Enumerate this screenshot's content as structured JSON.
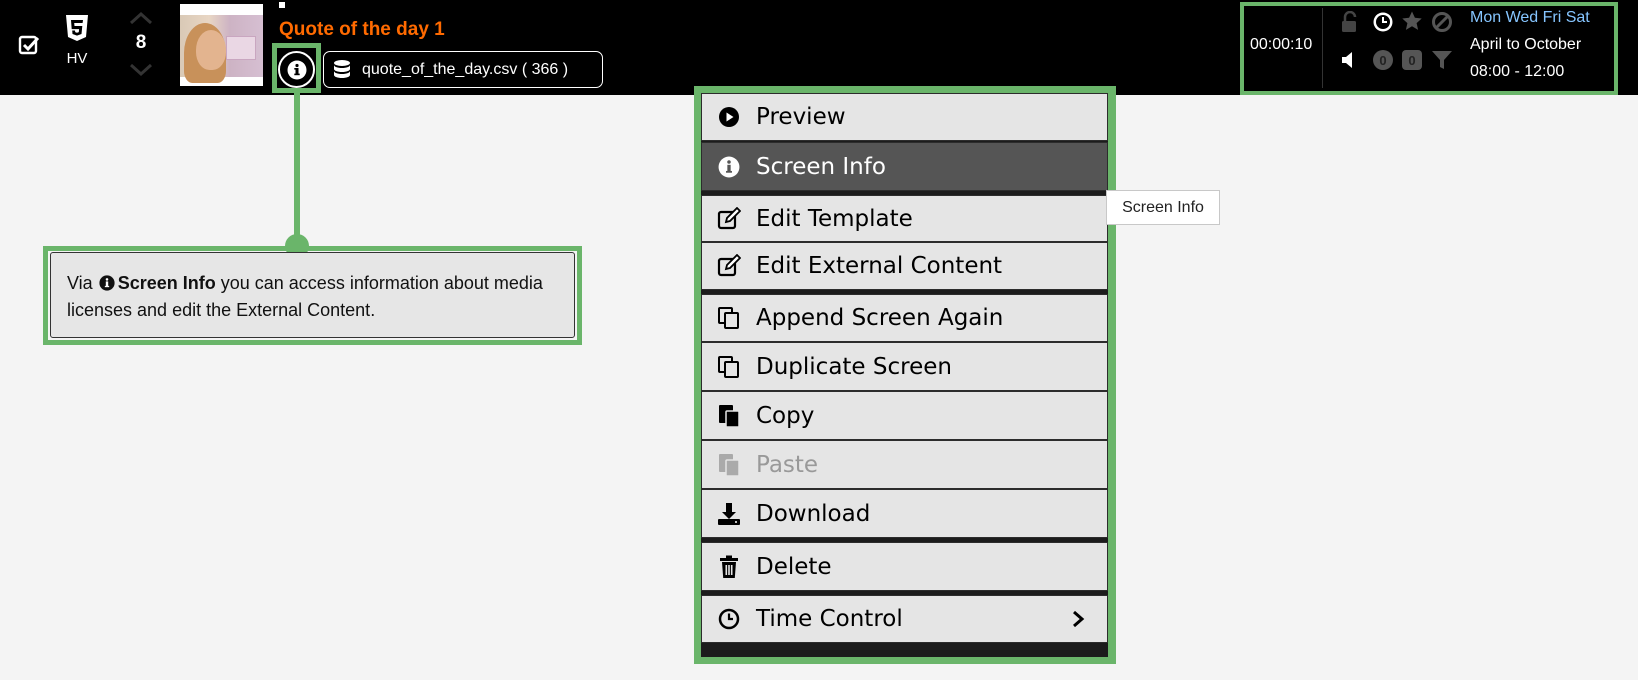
{
  "topbar": {
    "format_label": "HV",
    "order": "8",
    "title": "Quote of the day 1",
    "csv_label": "quote_of_the_day.csv ( 366 )",
    "duration": "00:00:10",
    "count_a": "0",
    "count_b": "0",
    "days": "Mon Wed Fri Sat",
    "months": "April to October",
    "hours": "08:00 - 12:00",
    "title_color": "#ff6a00",
    "days_color": "#86c5ff"
  },
  "callout": {
    "prefix": "Via",
    "bold": "Screen Info",
    "suffix": " you can access information about media licenses and edit the External Content."
  },
  "menu": {
    "items": [
      {
        "label": "Preview",
        "icon": "play-circle-icon"
      },
      {
        "label": "Screen Info",
        "icon": "info-circle-icon"
      },
      {
        "label": "Edit Template",
        "icon": "edit-icon"
      },
      {
        "label": "Edit External Content",
        "icon": "edit-icon"
      },
      {
        "label": "Append Screen Again",
        "icon": "copy-icon"
      },
      {
        "label": "Duplicate Screen",
        "icon": "copy-icon"
      },
      {
        "label": "Copy",
        "icon": "clipboard-icon"
      },
      {
        "label": "Paste",
        "icon": "paste-icon"
      },
      {
        "label": "Download",
        "icon": "download-icon"
      },
      {
        "label": "Delete",
        "icon": "trash-icon"
      },
      {
        "label": "Time Control",
        "icon": "clock-icon"
      }
    ]
  },
  "tooltip": "Screen Info",
  "accent_color": "#6ab56a"
}
